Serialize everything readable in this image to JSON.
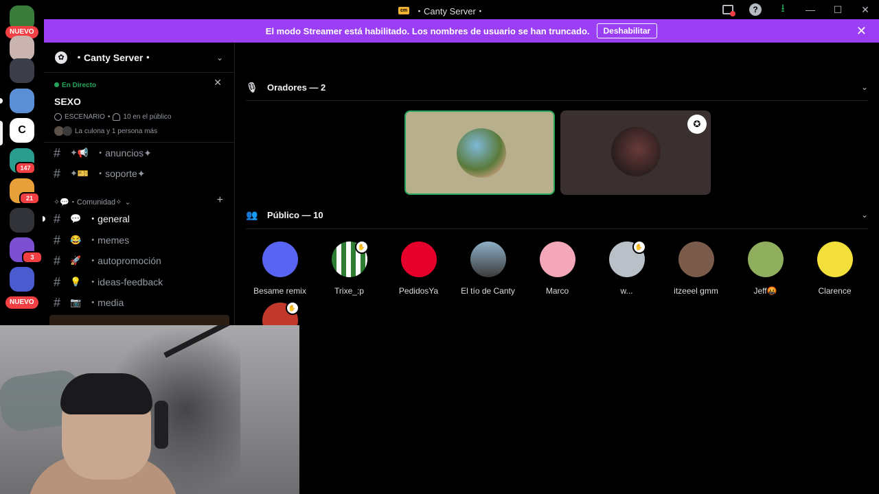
{
  "window": {
    "title": "・Canty Server・"
  },
  "rail": {
    "nuevo_top": "NUEVO",
    "nuevo_bottom": "NUEVO",
    "badges": [
      "147",
      "21",
      "3"
    ]
  },
  "banner": {
    "text": "El modo Streamer está habilitado. Los nombres de usuario se han truncado.",
    "button": "Deshabilitar"
  },
  "sidebar": {
    "server_name": "・Canty Server・",
    "live": {
      "label": "En Directo",
      "stage_name": "SEXO",
      "meta_type": "ESCENARIO",
      "meta_audience": "10 en el público",
      "people": "La culona y 1 persona más"
    },
    "channels": [
      {
        "emoji": "✦📢",
        "name": "・anuncios✦"
      },
      {
        "emoji": "✦🎫",
        "name": "・soporte✦"
      }
    ],
    "category": "✧💬・Comunidad✧",
    "community_channels": [
      {
        "emoji": "💬",
        "name": "・general"
      },
      {
        "emoji": "😂",
        "name": "・memes"
      },
      {
        "emoji": "🚀",
        "name": "・autopromoción"
      },
      {
        "emoji": "💡",
        "name": "・ideas-feedback"
      },
      {
        "emoji": "📷",
        "name": "・media"
      }
    ]
  },
  "stage": {
    "speakers_header": "Oradores — 2",
    "audience_header": "Público — 10",
    "audience": [
      {
        "name": "Besame remix",
        "color": "#5865f2"
      },
      {
        "name": "Trixe_:p",
        "color": "#2e7d32"
      },
      {
        "name": "PedidosYa",
        "color": "#e4002b"
      },
      {
        "name": "El tío de Canty",
        "color": "#6b8fa8"
      },
      {
        "name": "Marco",
        "color": "#f4a7b9"
      },
      {
        "name": "w...",
        "color": "#b9c0c8"
      },
      {
        "name": "itzeeel gmm",
        "color": "#7a5a4a"
      },
      {
        "name": "Jeff🤬",
        "color": "#8fae5e"
      },
      {
        "name": "Clarence",
        "color": "#f4e03a"
      },
      {
        "name": "",
        "color": "#c0392b"
      }
    ]
  },
  "colors": {
    "accent": "#9b3ff4",
    "live": "#23a55a",
    "speaking": "#23a55a",
    "badge": "#f23f43"
  },
  "icons": [
    "inbox-icon",
    "help-icon",
    "download-icon",
    "minimize-icon",
    "maximize-icon",
    "close-icon",
    "gear-icon",
    "chevron-down-icon",
    "microphone-icon",
    "people-icon",
    "hash-icon",
    "hand-raise-icon",
    "moderator-icon",
    "headphones-icon",
    "stage-icon",
    "plus-icon",
    "discord-logo-icon"
  ]
}
